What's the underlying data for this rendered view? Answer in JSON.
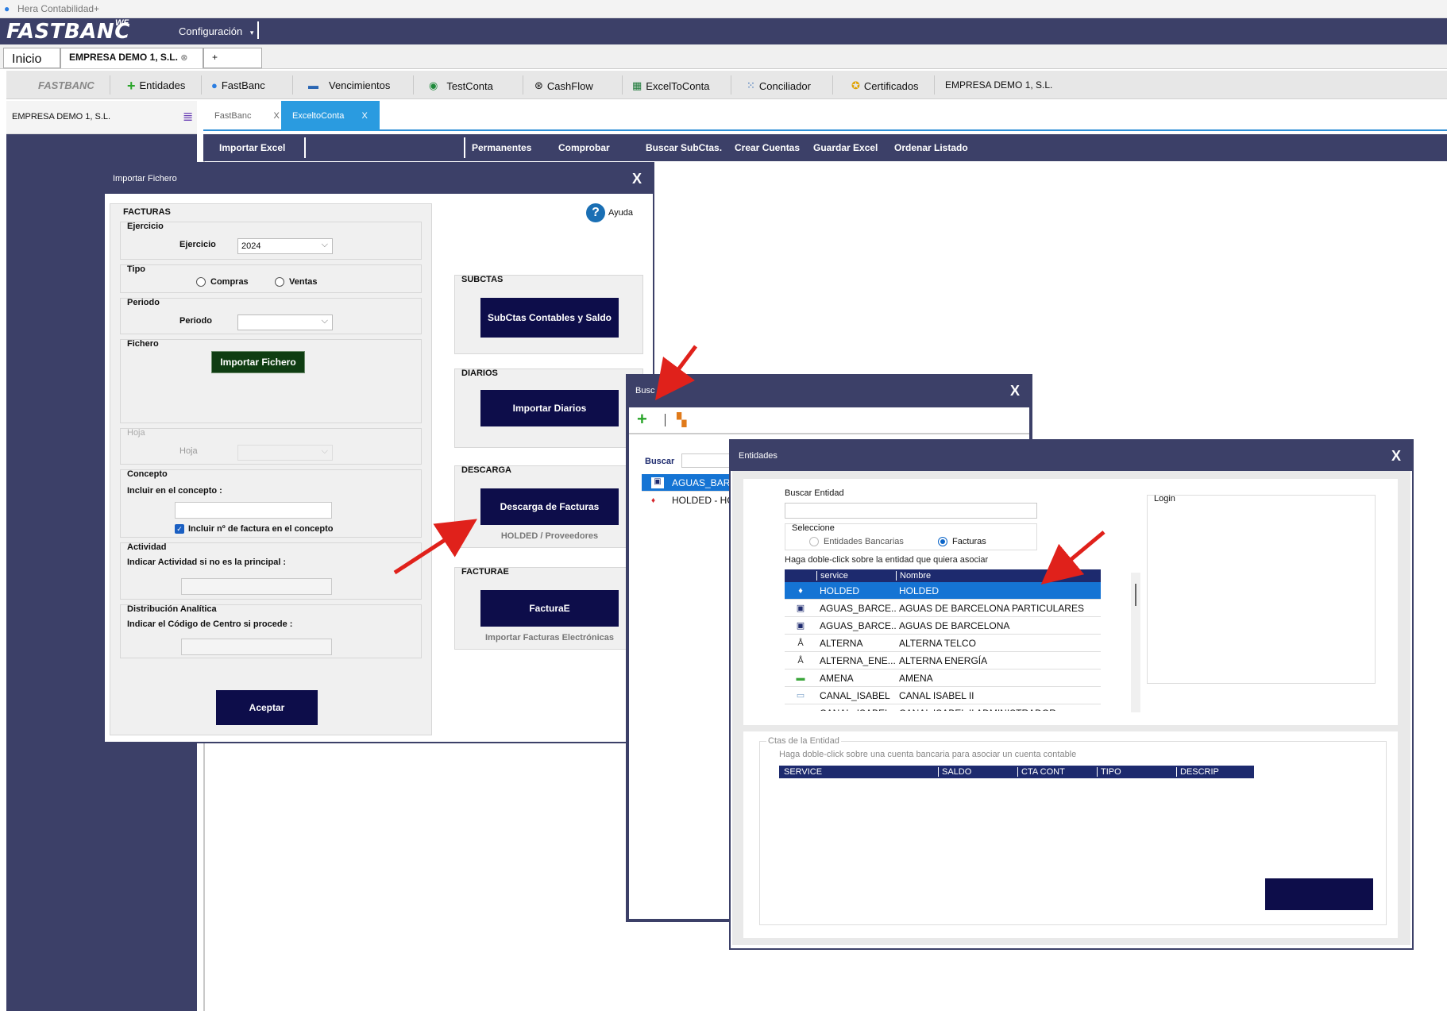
{
  "window": {
    "title": "Hera Contabilidad+"
  },
  "app": {
    "logo": "FASTBANC",
    "logo_suffix": "WF",
    "config_menu": "Configuración"
  },
  "tabs": {
    "home": "Inicio",
    "company": "EMPRESA DEMO 1, S.L.",
    "new": "+"
  },
  "toolbar": {
    "brand": "FASTBANC",
    "items": [
      "Entidades",
      "FastBanc",
      "Vencimientos",
      "TestConta",
      "CashFlow",
      "ExcelToConta",
      "Conciliador",
      "Certificados"
    ],
    "company": "EMPRESA DEMO 1, S.L."
  },
  "sidebar": {
    "company": "EMPRESA DEMO 1, S.L."
  },
  "content_tabs": [
    {
      "label": "FastBanc",
      "close": "X"
    },
    {
      "label": "ExceltoConta",
      "close": "X"
    }
  ],
  "action_bar": {
    "import_excel": "Importar Excel",
    "items": [
      "Permanentes",
      "Comprobar",
      "Buscar SubCtas.",
      "Crear Cuentas",
      "Guardar Excel",
      "Ordenar Listado"
    ]
  },
  "import_dialog": {
    "title": "Importar Fichero",
    "close": "X",
    "help": "Ayuda",
    "facturas": "FACTURAS",
    "ejercicio_group": "Ejercicio",
    "ejercicio_label": "Ejercicio",
    "ejercicio_value": "2024",
    "tipo_group": "Tipo",
    "compras": "Compras",
    "ventas": "Ventas",
    "periodo_group": "Periodo",
    "periodo_label": "Periodo",
    "fichero_group": "Fichero",
    "importar_fichero": "Importar Fichero",
    "hoja_group": "Hoja",
    "hoja_label": "Hoja",
    "concepto_group": "Concepto",
    "incluir_concepto": "Incluir en el  concepto :",
    "incluir_factura": "Incluir nº de factura en el concepto",
    "actividad_group": "Actividad",
    "actividad_label": "Indicar Actividad si no es la principal :",
    "analitica_group": "Distribución Analítica",
    "analitica_label": "Indicar el Código de Centro si procede :",
    "aceptar": "Aceptar",
    "subctas": "SUBCTAS",
    "subctas_btn": "SubCtas Contables y Saldo",
    "diarios": "DIARIOS",
    "diarios_btn": "Importar Diarios",
    "descarga": "DESCARGA",
    "descarga_btn": "Descarga de Facturas",
    "descarga_sub": "HOLDED / Proveedores",
    "facturae": "FACTURAE",
    "facturae_btn": "FacturaE",
    "facturae_sub": "Importar Facturas Electrónicas"
  },
  "buscar_dialog": {
    "title": "Busc",
    "close": "X",
    "buscar_label": "Buscar",
    "rows": [
      "AGUAS_BARC",
      "HOLDED - HO"
    ]
  },
  "entidades_dialog": {
    "title": "Entidades",
    "close": "X",
    "buscar_entidad": "Buscar Entidad",
    "seleccione": "Seleccione",
    "opt_bancarias": "Entidades Bancarias",
    "opt_facturas": "Facturas",
    "hint": "Haga doble-click sobre la entidad que quiera asociar",
    "login": "Login",
    "columns": [
      "service",
      "Nombre"
    ],
    "rows": [
      {
        "service": "HOLDED",
        "nombre": "HOLDED",
        "icon": "holded-icon"
      },
      {
        "service": "AGUAS_BARCE...",
        "nombre": "AGUAS DE BARCELONA PARTICULARES",
        "icon": "agbar-icon"
      },
      {
        "service": "AGUAS_BARCE...",
        "nombre": "AGUAS DE BARCELONA",
        "icon": "agbar-icon"
      },
      {
        "service": "ALTERNA",
        "nombre": "ALTERNA TELCO",
        "icon": "alterna-icon"
      },
      {
        "service": "ALTERNA_ENE...",
        "nombre": "ALTERNA ENERGÍA",
        "icon": "alterna-icon"
      },
      {
        "service": "AMENA",
        "nombre": "AMENA",
        "icon": "amena-icon"
      },
      {
        "service": "CANAL_ISABEL",
        "nombre": "CANAL ISABEL II",
        "icon": "canal-icon"
      },
      {
        "service": "CANAL_ISABEL",
        "nombre": "CANAL ISABEL II ADMINISTRADOR",
        "icon": "canal-icon"
      }
    ],
    "ctas_group": "Ctas de la Entidad",
    "ctas_hint": "Haga doble-click sobre una cuenta bancaria para asociar un cuenta contable",
    "ctas_columns": [
      "SERVICE",
      "SALDO",
      "CTA CONT",
      "TIPO",
      "DESCRIP"
    ]
  },
  "colors": {
    "navy": "#3c4068",
    "button": "#0d0d4a",
    "accent": "#1574d4",
    "arrow": "#e0211b"
  }
}
